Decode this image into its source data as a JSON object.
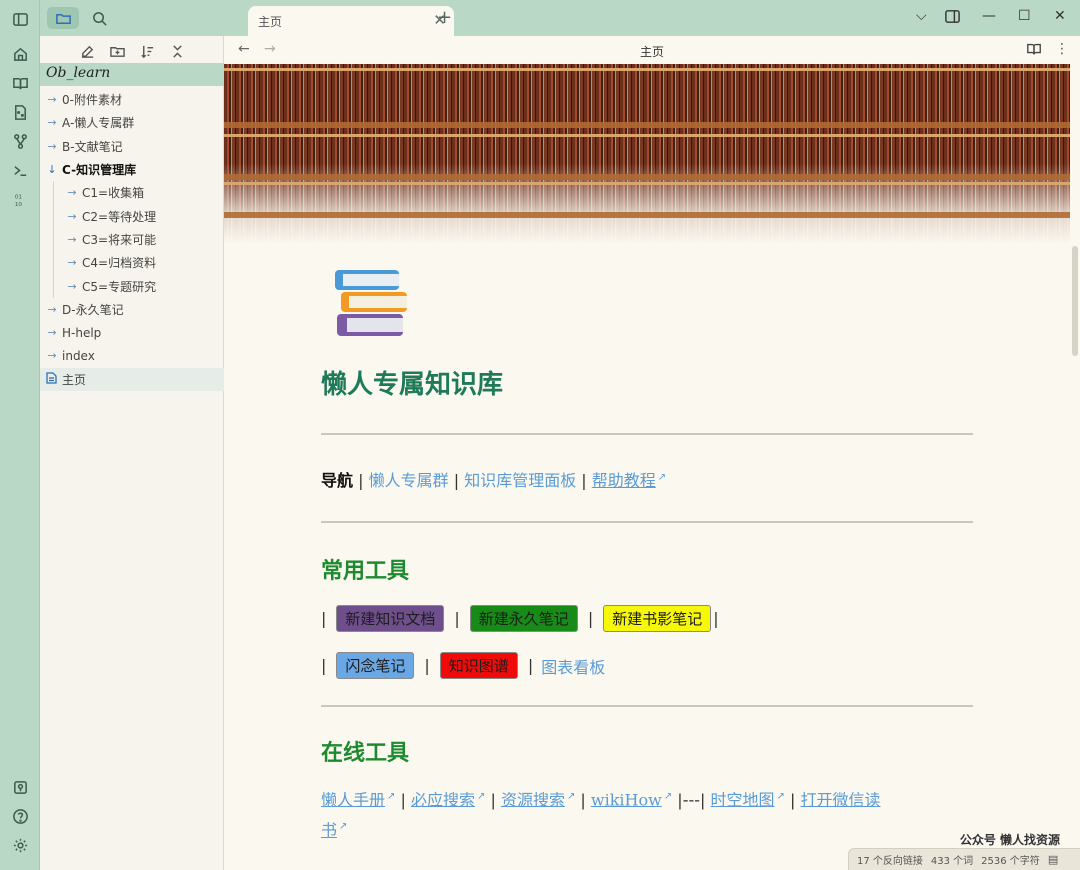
{
  "tab": {
    "title": "主页"
  },
  "navbar": {
    "title": "主页"
  },
  "explorer": {
    "vault_name": "Ob_learn",
    "items": [
      {
        "label": "0-附件素材"
      },
      {
        "label": "A-懒人专属群"
      },
      {
        "label": "B-文献笔记"
      },
      {
        "label": "C-知识管理库"
      },
      {
        "label": "C1=收集箱"
      },
      {
        "label": "C2=等待处理"
      },
      {
        "label": "C3=将来可能"
      },
      {
        "label": "C4=归档资料"
      },
      {
        "label": "C5=专题研究"
      },
      {
        "label": "D-永久笔记"
      },
      {
        "label": "H-help"
      },
      {
        "label": "index"
      },
      {
        "label": "主页"
      }
    ]
  },
  "page": {
    "title": "懒人专属知识库",
    "nav": {
      "label": "导航",
      "sep": "|",
      "links": [
        "懒人专属群",
        "知识库管理面板",
        "帮助教程"
      ]
    },
    "common_tools": {
      "heading": "常用工具",
      "buttons_row1": [
        "新建知识文档",
        "新建永久笔记",
        "新建书影笔记"
      ],
      "buttons_row2": [
        "闪念笔记",
        "知识图谱"
      ],
      "chart_board": "图表看板"
    },
    "online_tools": {
      "heading": "在线工具",
      "links": [
        "懒人手册",
        "必应搜索",
        "资源搜索",
        "wikiHow",
        "时空地图",
        "打开微信读",
        "书"
      ],
      "dash": "|---|"
    }
  },
  "status": {
    "backlinks": "17 个反向链接",
    "words": "433 个词",
    "chars": "2536 个字符"
  },
  "watermark": "公众号 懒人找资源",
  "colors": {
    "ribbon": "#b9d8c6",
    "title_green": "#1f7a5a",
    "section_green": "#1d8a2d",
    "link_blue": "#5b9bd5"
  }
}
